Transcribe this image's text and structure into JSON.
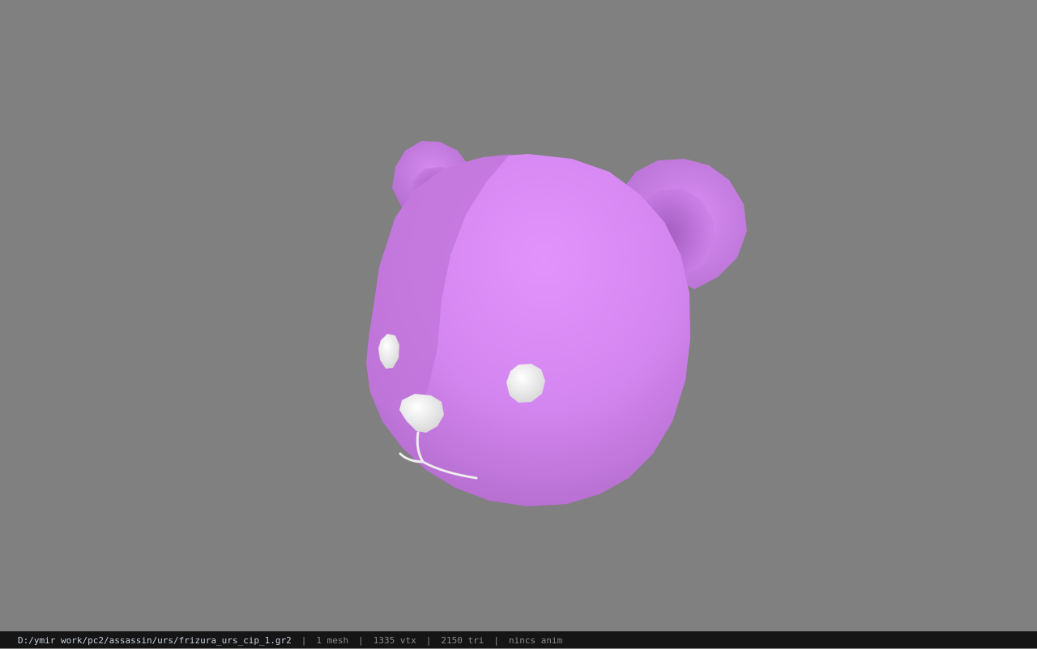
{
  "viewport": {
    "background": "#808080",
    "model": {
      "name": "bear-head",
      "color": "#d98cf5",
      "detail_color": "#eeeeee"
    }
  },
  "status_bar": {
    "file_path": "D:/ymir work/pc2/assassin/urs/frizura_urs_cip_1.gr2",
    "separator": "|",
    "mesh_count": "1 mesh",
    "vertex_count": "1335 vtx",
    "triangle_count": "2150 tri",
    "anim_status": "nincs anim"
  }
}
